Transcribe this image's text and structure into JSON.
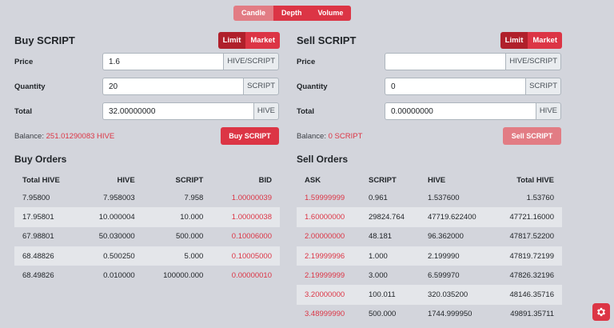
{
  "chart_tabs": [
    "Candle",
    "Depth",
    "Volume"
  ],
  "buy": {
    "title": "Buy SCRIPT",
    "type_tabs": [
      "Limit",
      "Market"
    ],
    "price_label": "Price",
    "price_value": "1.6",
    "price_suffix": "HIVE/SCRIPT",
    "quantity_label": "Quantity",
    "quantity_value": "20",
    "quantity_suffix": "SCRIPT",
    "total_label": "Total",
    "total_value": "32.00000000",
    "total_suffix": "HIVE",
    "balance_label": "Balance:",
    "balance_value": "251.01290083 HIVE",
    "button_label": "Buy SCRIPT"
  },
  "sell": {
    "title": "Sell SCRIPT",
    "type_tabs": [
      "Limit",
      "Market"
    ],
    "price_label": "Price",
    "price_value": "",
    "price_suffix": "HIVE/SCRIPT",
    "quantity_label": "Quantity",
    "quantity_value": "0",
    "quantity_suffix": "SCRIPT",
    "total_label": "Total",
    "total_value": "0.00000000",
    "total_suffix": "HIVE",
    "balance_label": "Balance:",
    "balance_value": "0 SCRIPT",
    "button_label": "Sell SCRIPT"
  },
  "buy_orders": {
    "title": "Buy Orders",
    "headers": [
      "Total HIVE",
      "HIVE",
      "SCRIPT",
      "BID"
    ],
    "rows": [
      [
        "7.95800",
        "7.958003",
        "7.958",
        "1.00000039"
      ],
      [
        "17.95801",
        "10.000004",
        "10.000",
        "1.00000038"
      ],
      [
        "67.98801",
        "50.030000",
        "500.000",
        "0.10006000"
      ],
      [
        "68.48826",
        "0.500250",
        "5.000",
        "0.10005000"
      ],
      [
        "68.49826",
        "0.010000",
        "100000.000",
        "0.00000010"
      ]
    ]
  },
  "sell_orders": {
    "title": "Sell Orders",
    "headers": [
      "ASK",
      "SCRIPT",
      "HIVE",
      "Total HIVE"
    ],
    "rows": [
      [
        "1.59999999",
        "0.961",
        "1.537600",
        "1.53760"
      ],
      [
        "1.60000000",
        "29824.764",
        "47719.622400",
        "47721.16000"
      ],
      [
        "2.00000000",
        "48.181",
        "96.362000",
        "47817.52200"
      ],
      [
        "2.19999996",
        "1.000",
        "2.199990",
        "47819.72199"
      ],
      [
        "2.19999999",
        "3.000",
        "6.599970",
        "47826.32196"
      ],
      [
        "3.20000000",
        "100.011",
        "320.035200",
        "48146.35716"
      ],
      [
        "3.48999990",
        "500.000",
        "1744.999950",
        "49891.35711"
      ]
    ]
  },
  "icons": {
    "settings": "gear-icon"
  },
  "colors": {
    "accent": "#dc3545",
    "accent_light": "#e27c84",
    "accent_dark": "#b0202b",
    "background": "#d3d5dc"
  }
}
